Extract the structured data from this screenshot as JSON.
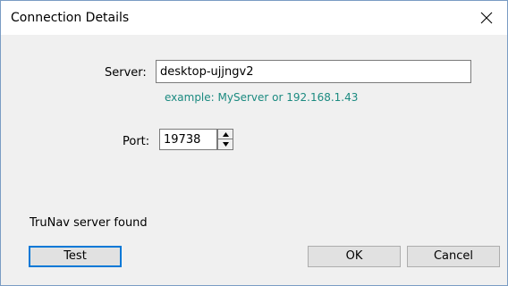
{
  "window": {
    "title": "Connection Details",
    "close_icon": "close-icon"
  },
  "server": {
    "label": "Server:",
    "value": "desktop-ujjngv2",
    "hint": "example: MyServer or 192.168.1.43"
  },
  "port": {
    "label": "Port:",
    "value": "19738"
  },
  "status": {
    "text": "TruNav server found"
  },
  "buttons": {
    "test": "Test",
    "ok": "OK",
    "cancel": "Cancel"
  },
  "colors": {
    "hint": "#1b8a80",
    "focus_border": "#0078d7",
    "dialog_bg": "#f0f0f0"
  }
}
